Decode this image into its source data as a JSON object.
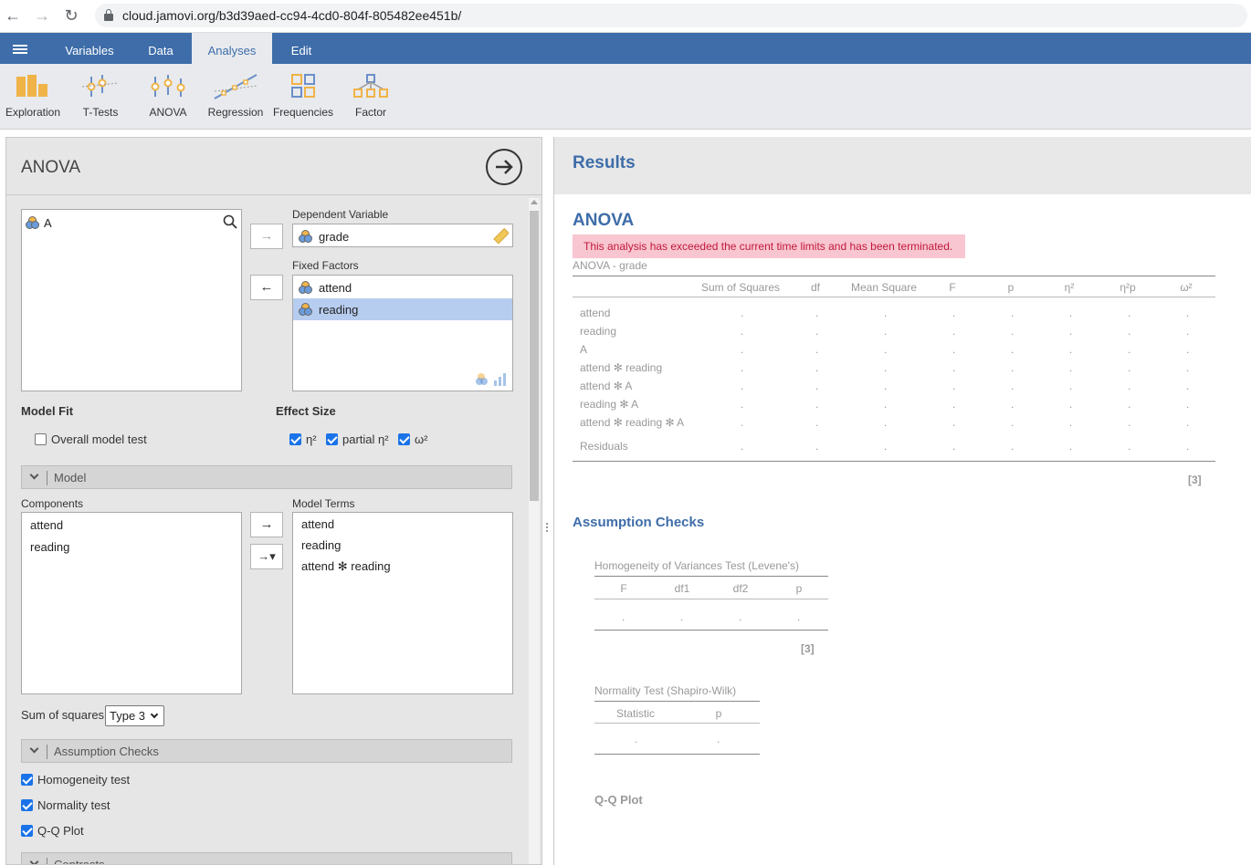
{
  "browser": {
    "url": "cloud.jamovi.org/b3d39aed-cc94-4cd0-804f-805482ee451b/"
  },
  "ribbon": {
    "tabs": [
      {
        "label": "Variables"
      },
      {
        "label": "Data"
      },
      {
        "label": "Analyses",
        "active": true
      },
      {
        "label": "Edit"
      }
    ]
  },
  "toolbar": {
    "items": [
      {
        "label": "Exploration",
        "icon": "exploration-icon"
      },
      {
        "label": "T-Tests",
        "icon": "t-tests-icon"
      },
      {
        "label": "ANOVA",
        "icon": "anova-icon"
      },
      {
        "label": "Regression",
        "icon": "regression-icon"
      },
      {
        "label": "Frequencies",
        "icon": "frequencies-icon"
      },
      {
        "label": "Factor",
        "icon": "factor-icon"
      }
    ]
  },
  "options": {
    "title": "ANOVA",
    "available_variables": [
      "A"
    ],
    "dependent_label": "Dependent Variable",
    "dependent_value": "grade",
    "fixed_factors_label": "Fixed Factors",
    "fixed_factors": [
      "attend",
      "reading"
    ],
    "model_fit_label": "Model Fit",
    "overall_model_test": "Overall model test",
    "effect_size_label": "Effect Size",
    "effect_sizes": [
      "η²",
      "partial η²",
      "ω²"
    ],
    "model_section": "Model",
    "components_label": "Components",
    "components": [
      "attend",
      "reading"
    ],
    "model_terms_label": "Model Terms",
    "model_terms": [
      "attend",
      "reading",
      "attend ✻ reading"
    ],
    "sum_of_squares_label": "Sum of squares",
    "sum_of_squares_value": "Type 3",
    "assumption_section": "Assumption Checks",
    "checks": [
      "Homogeneity test",
      "Normality test",
      "Q-Q Plot"
    ],
    "contrasts_section": "Contrasts"
  },
  "results": {
    "header": "Results",
    "anova_heading": "ANOVA",
    "error": "This analysis has exceeded the current time limits and has been terminated.",
    "anova_caption": "ANOVA - grade",
    "anova_columns": [
      "Sum of Squares",
      "df",
      "Mean Square",
      "F",
      "p",
      "η²",
      "η²p",
      "ω²"
    ],
    "anova_rows": [
      "attend",
      "reading",
      "A",
      "attend ✻ reading",
      "attend ✻ A",
      "reading ✻ A",
      "attend ✻ reading ✻ A",
      "Residuals"
    ],
    "placeholder": ".",
    "anova_note": "[3]",
    "assumption_heading": "Assumption Checks",
    "levene_caption": "Homogeneity of Variances Test (Levene's)",
    "levene_columns": [
      "F",
      "df1",
      "df2",
      "p"
    ],
    "levene_note": "[3]",
    "normality_caption": "Normality Test (Shapiro-Wilk)",
    "normality_columns": [
      "Statistic",
      "p"
    ],
    "qq_heading": "Q-Q Plot"
  }
}
